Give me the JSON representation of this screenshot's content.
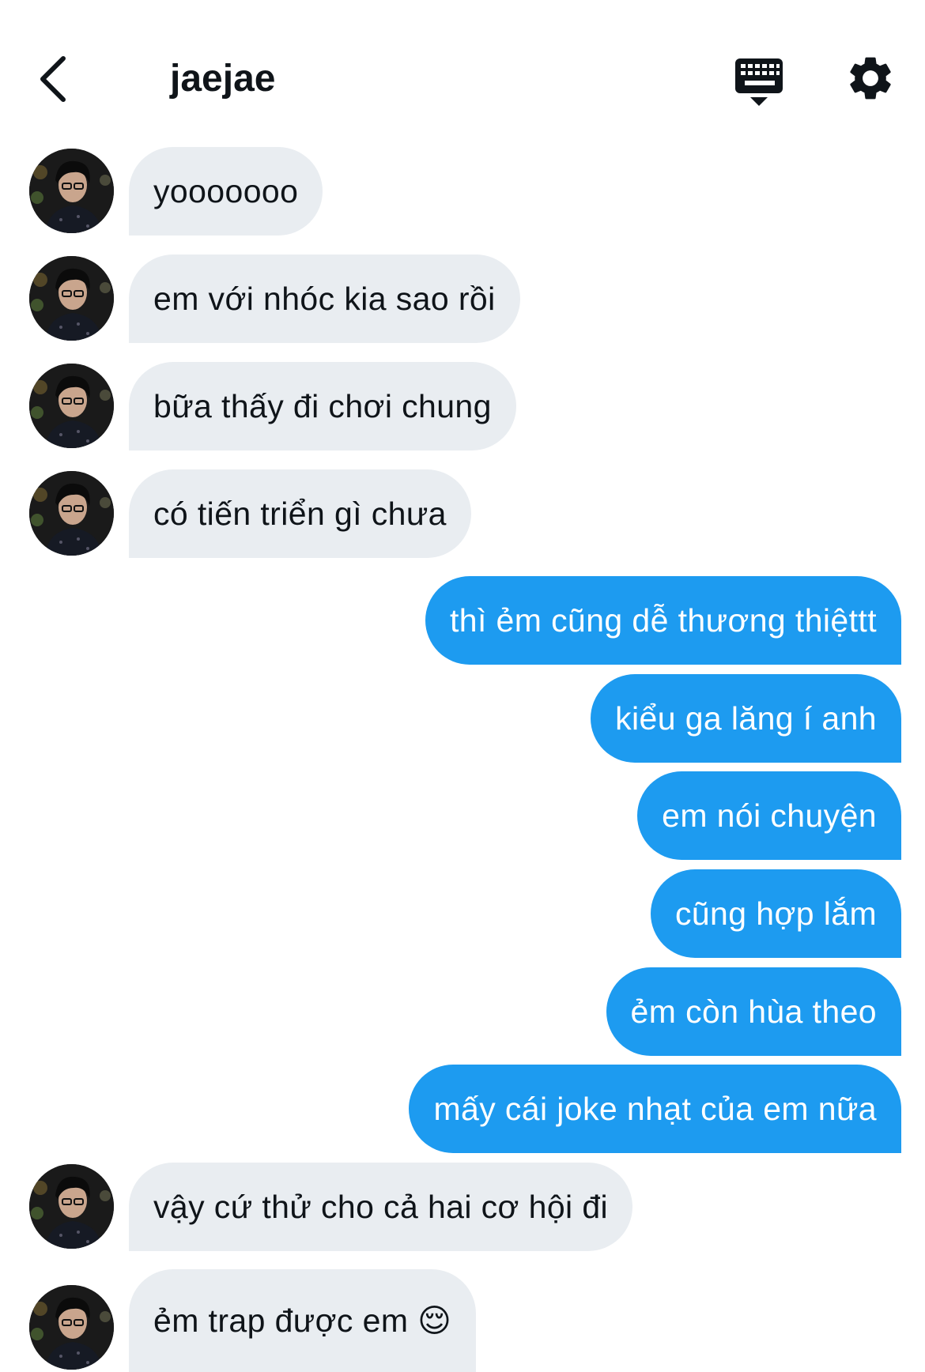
{
  "header": {
    "title": "jaejae"
  },
  "icons": {
    "back": "chevron-left-icon",
    "keyboard": "keyboard-icon",
    "settings": "gear-icon"
  },
  "colors": {
    "incoming_bubble": "#e9edf1",
    "outgoing_bubble": "#1d9bf0",
    "text_dark": "#0f1419",
    "text_light": "#ffffff"
  },
  "messages": [
    {
      "dir": "in",
      "text": "yooooooo"
    },
    {
      "dir": "in",
      "text": "em với nhóc kia sao rồi"
    },
    {
      "dir": "in",
      "text": "bữa thấy đi chơi chung"
    },
    {
      "dir": "in",
      "text": "có tiến triển gì chưa"
    },
    {
      "dir": "out",
      "text": "thì ẻm cũng dễ thương thiệttt"
    },
    {
      "dir": "out",
      "text": "kiểu ga lăng í anh"
    },
    {
      "dir": "out",
      "text": "em nói chuyện"
    },
    {
      "dir": "out",
      "text": "cũng hợp lắm"
    },
    {
      "dir": "out",
      "text": "ẻm còn hùa theo"
    },
    {
      "dir": "out",
      "text": "mấy cái joke nhạt của em nữa"
    },
    {
      "dir": "in",
      "text": "vậy cứ thử cho cả hai cơ hội đi"
    },
    {
      "dir": "in",
      "text": "ẻm trap được em 😌"
    }
  ]
}
